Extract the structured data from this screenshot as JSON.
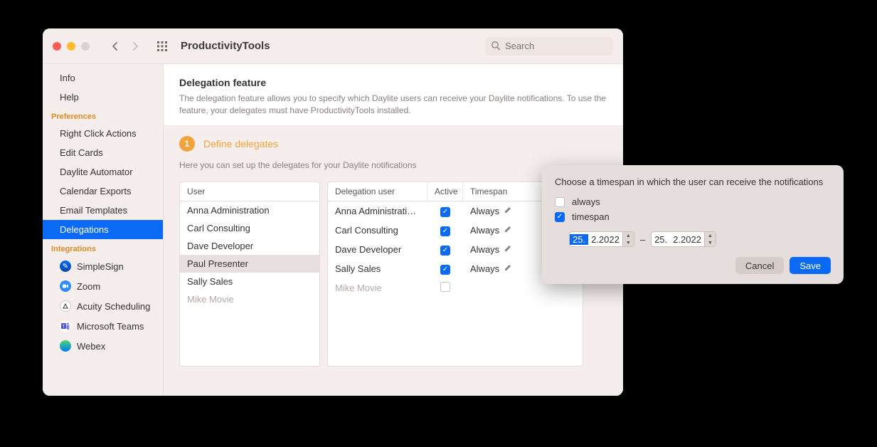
{
  "header": {
    "app_title": "ProductivityTools",
    "search_placeholder": "Search"
  },
  "sidebar": {
    "top": [
      {
        "label": "Info"
      },
      {
        "label": "Help"
      }
    ],
    "preferences_label": "Preferences",
    "preferences": [
      {
        "label": "Right Click Actions"
      },
      {
        "label": "Edit Cards"
      },
      {
        "label": "Daylite Automator"
      },
      {
        "label": "Calendar Exports"
      },
      {
        "label": "Email Templates"
      },
      {
        "label": "Delegations",
        "active": true
      }
    ],
    "integrations_label": "Integrations",
    "integrations": [
      {
        "label": "SimpleSign"
      },
      {
        "label": "Zoom"
      },
      {
        "label": "Acuity Scheduling"
      },
      {
        "label": "Microsoft Teams"
      },
      {
        "label": "Webex"
      }
    ]
  },
  "main": {
    "title": "Delegation feature",
    "description": "The delegation feature allows you to specify which Daylite users can receive your Daylite notifications. To use the feature, your delegates must have ProductivityTools installed.",
    "step_number": "1",
    "step_title": "Define delegates",
    "step_desc": "Here you can set up the delegates for your Daylite notifications",
    "users_header": "User",
    "users": [
      {
        "name": "Anna Administration"
      },
      {
        "name": "Carl Consulting"
      },
      {
        "name": "Dave Developer"
      },
      {
        "name": "Paul Presenter",
        "selected": true
      },
      {
        "name": "Sally Sales"
      },
      {
        "name": "Mike Movie",
        "dim": true
      }
    ],
    "del_headers": {
      "user": "Delegation user",
      "active": "Active",
      "timespan": "Timespan"
    },
    "delegation": [
      {
        "user": "Anna Administrati…",
        "active": true,
        "timespan": "Always"
      },
      {
        "user": "Carl Consulting",
        "active": true,
        "timespan": "Always"
      },
      {
        "user": "Dave Developer",
        "active": true,
        "timespan": "Always"
      },
      {
        "user": "Sally Sales",
        "active": true,
        "timespan": "Always"
      },
      {
        "user": "Mike Movie",
        "active": false,
        "timespan": "",
        "dim": true
      }
    ]
  },
  "popover": {
    "title": "Choose a timespan in which the user can receive the notifications",
    "option_always": "always",
    "option_timespan": "timespan",
    "selected": "timespan",
    "from": {
      "day": "25.",
      "rest": "2.2022"
    },
    "dash": "–",
    "to": {
      "day": "25.",
      "rest": "2.2022"
    },
    "cancel": "Cancel",
    "save": "Save"
  }
}
